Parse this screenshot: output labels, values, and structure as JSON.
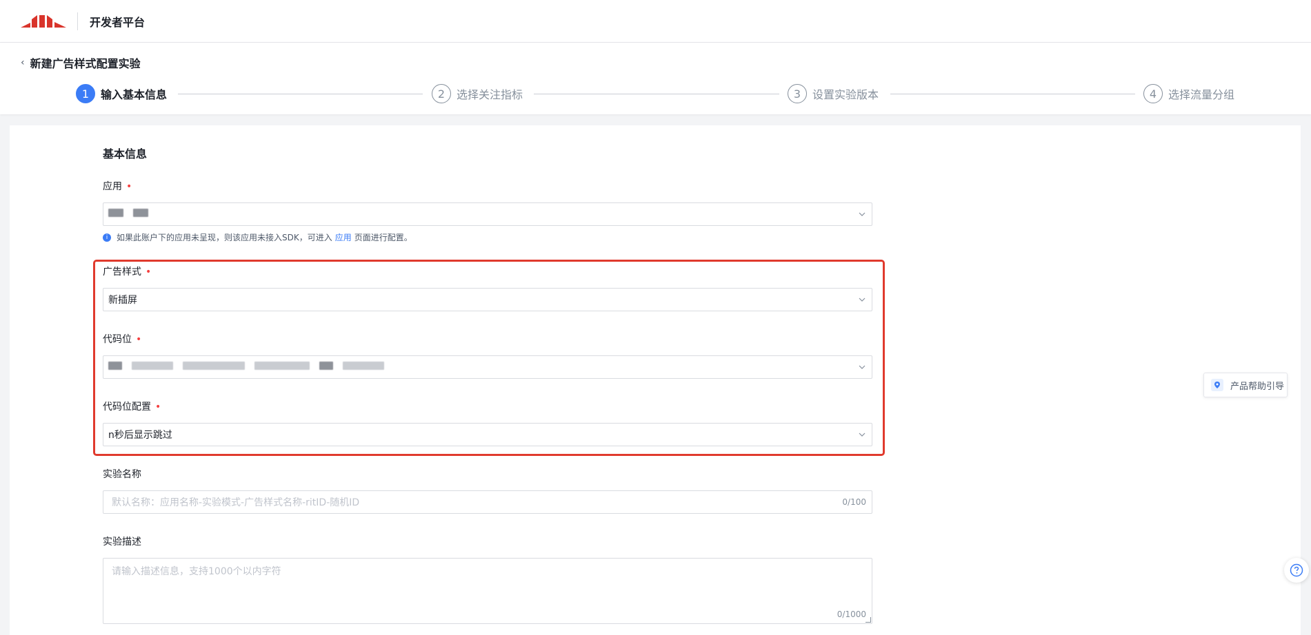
{
  "header": {
    "brand": "开发者平台"
  },
  "page": {
    "title": "新建广告样式配置实验"
  },
  "steps": [
    {
      "num": "1",
      "label": "输入基本信息",
      "active": true
    },
    {
      "num": "2",
      "label": "选择关注指标",
      "active": false
    },
    {
      "num": "3",
      "label": "设置实验版本",
      "active": false
    },
    {
      "num": "4",
      "label": "选择流量分组",
      "active": false
    }
  ],
  "form": {
    "section_title": "基本信息",
    "app": {
      "label": "应用",
      "value": "",
      "hint_before": "如果此账户下的应用未呈现，则该应用未接入SDK，可进入",
      "hint_link": "应用",
      "hint_after": "页面进行配置。"
    },
    "ad_style": {
      "label": "广告样式",
      "value": "新插屏"
    },
    "code_slot": {
      "label": "代码位",
      "value": ""
    },
    "code_slot_config": {
      "label": "代码位配置",
      "value": "n秒后显示跳过"
    },
    "experiment_name": {
      "label": "实验名称",
      "placeholder": "默认名称：应用名称-实验模式-广告样式名称-ritID-随机ID",
      "counter": "0/100"
    },
    "experiment_desc": {
      "label": "实验描述",
      "placeholder": "请输入描述信息，支持1000个以内字符",
      "counter": "0/1000"
    }
  },
  "floating": {
    "help_guide": "产品帮助引导"
  },
  "colors": {
    "primary": "#3b7cf6",
    "required": "#f53f3f",
    "highlight": "#e03a2d"
  }
}
